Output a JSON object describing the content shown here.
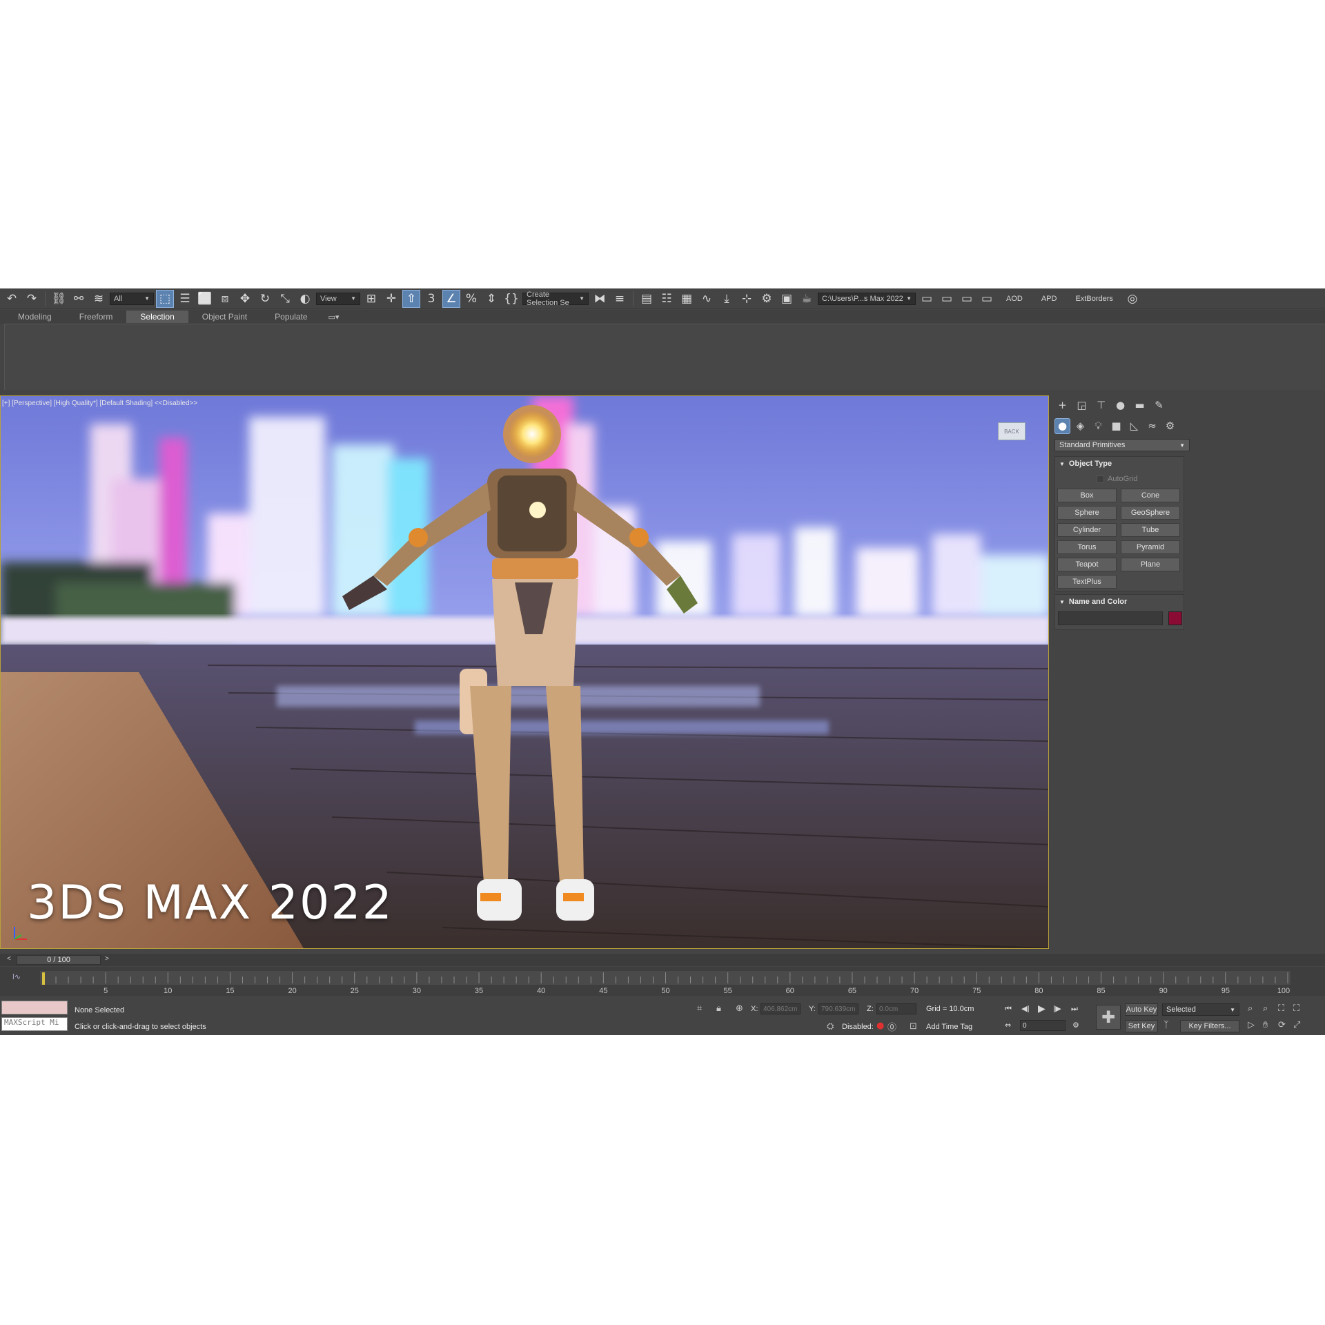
{
  "toolbar": {
    "selection_filter": "All",
    "ref_coord": "View",
    "named_selection": "Create Selection Se",
    "project_path": "C:\\Users\\P...s Max 2022",
    "aod_label": "AOD",
    "apd_label": "APD",
    "extborders_label": "ExtBorders"
  },
  "ribbon": {
    "tabs": [
      "Modeling",
      "Freeform",
      "Selection",
      "Object Paint",
      "Populate"
    ],
    "active_tab": "Selection"
  },
  "viewport": {
    "label": "[+] [Perspective] [High Quality*] [Default Shading] <<Disabled>>",
    "overlay_title": "3DS MAX 2022",
    "viewcube_label": "BACK"
  },
  "command_panel": {
    "category": "Standard Primitives",
    "object_type_title": "Object Type",
    "autogrid_label": "AutoGrid",
    "primitives": [
      "Box",
      "Cone",
      "Sphere",
      "GeoSphere",
      "Cylinder",
      "Tube",
      "Torus",
      "Pyramid",
      "Teapot",
      "Plane",
      "TextPlus"
    ],
    "name_color_title": "Name and Color",
    "object_color": "#8a0b33"
  },
  "timeline": {
    "frame_display": "0 / 100",
    "ticks": [
      "5",
      "10",
      "15",
      "20",
      "25",
      "30",
      "35",
      "40",
      "45",
      "50",
      "55",
      "60",
      "65",
      "70",
      "75",
      "80",
      "85",
      "90",
      "95",
      "100"
    ]
  },
  "status": {
    "maxscript_label": "MAXScript Mi",
    "selection_status": "None Selected",
    "prompt": "Click or click-and-drag to select objects",
    "x_label": "X:",
    "x_value": "406.862cm",
    "y_label": "Y:",
    "y_value": "790.639cm",
    "z_label": "Z:",
    "z_value": "0.0cm",
    "grid": "Grid = 10.0cm",
    "disabled_label": "Disabled:",
    "add_time_tag": "Add Time Tag",
    "frame_field": "0",
    "auto_key": "Auto Key",
    "set_key": "Set Key",
    "key_mode": "Selected",
    "key_filters": "Key Filters..."
  }
}
